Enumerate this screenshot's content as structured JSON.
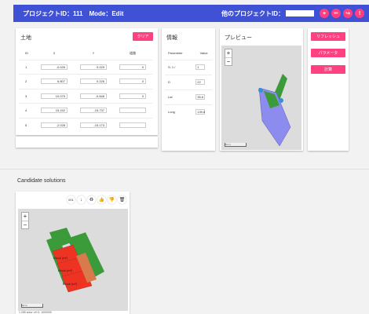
{
  "header": {
    "title": "プロジェクトID：111　Mode：Edit",
    "other_project_label": "他のプロジェクトID：",
    "buttons": [
      "+",
      "✏",
      "↪",
      "!"
    ]
  },
  "land": {
    "title": "土地",
    "clear_label": "クリア",
    "columns": [
      "ID",
      "X",
      "Y",
      "道路"
    ],
    "rows": [
      {
        "id": "1",
        "x": "-0.026",
        "y": "0.029",
        "road": "0"
      },
      {
        "id": "2",
        "x": "6.807",
        "y": "0.226",
        "road": "0"
      },
      {
        "id": "3",
        "x": "10.075",
        "y": "-0.848",
        "road": "0"
      },
      {
        "id": "4",
        "x": "15.152",
        "y": "-15.737",
        "road": ""
      },
      {
        "id": "5",
        "x": "-2.028",
        "y": "-15.173",
        "road": ""
      }
    ]
  },
  "info": {
    "title": "情報",
    "columns": [
      "Parameter",
      "Value"
    ],
    "rows": [
      {
        "param": "S: 1 /",
        "value": "1"
      },
      {
        "param": "D",
        "value": "22"
      },
      {
        "param": "Lat",
        "value": "35.6"
      },
      {
        "param": "Long",
        "value": "139.6"
      }
    ]
  },
  "preview": {
    "title": "プレビュー",
    "zoom_in": "+",
    "zoom_out": "−",
    "scale": "10 m"
  },
  "actions": {
    "refresh": "リフレッシュ",
    "params": "パラメータ",
    "calc": "計算"
  },
  "candidates": {
    "title": "Candidate solutions",
    "toolbar_label": "001",
    "toolbar_icons": [
      "↓",
      "♻",
      "👍",
      "👎",
      "🗑"
    ],
    "zoom_in": "+",
    "zoom_out": "−",
    "scale": "10 m",
    "block_labels": [
      "Block (m²)",
      "Block (m²)",
      "Block (m²)"
    ],
    "footer": "1.255  area: n/t  G: 1000000"
  },
  "colors": {
    "header": "#3f51d4",
    "accent": "#ff4081",
    "green": "#3b9b3b",
    "purple": "#8c8cee",
    "red": "#ee3322",
    "orange": "#d97a4d"
  }
}
